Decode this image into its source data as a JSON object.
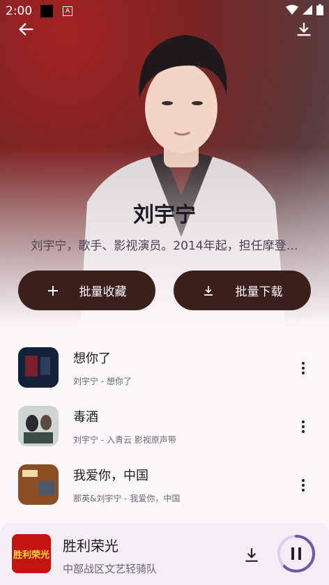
{
  "status_bar": {
    "time": "2:00",
    "notification_badge": "A"
  },
  "header": {
    "back_icon": "arrow-left-icon",
    "download_icon": "download-icon"
  },
  "artist": {
    "name": "刘宇宁",
    "description": "刘宇宁，歌手、影视演员。2014年起，担任摩登…"
  },
  "actions": {
    "collect_label": "批量收藏",
    "download_label": "批量下载"
  },
  "songs": [
    {
      "title": "想你了",
      "subtitle": "刘宇宁 - 想你了"
    },
    {
      "title": "毒酒",
      "subtitle": "刘宇宁 - 入青云 影视原声带"
    },
    {
      "title": "我爱你，中国",
      "subtitle": "那英&刘宇宁 - 我爱你，中国"
    }
  ],
  "now_playing": {
    "title": "胜利荣光",
    "artist": "中部战区文艺轻骑队",
    "cover_text": "胜利荣光",
    "progress": 0.62
  },
  "colors": {
    "pill_bg": "#3a1f1d",
    "ring": "#6a5aa8",
    "player_bg": "#f3edf6"
  }
}
